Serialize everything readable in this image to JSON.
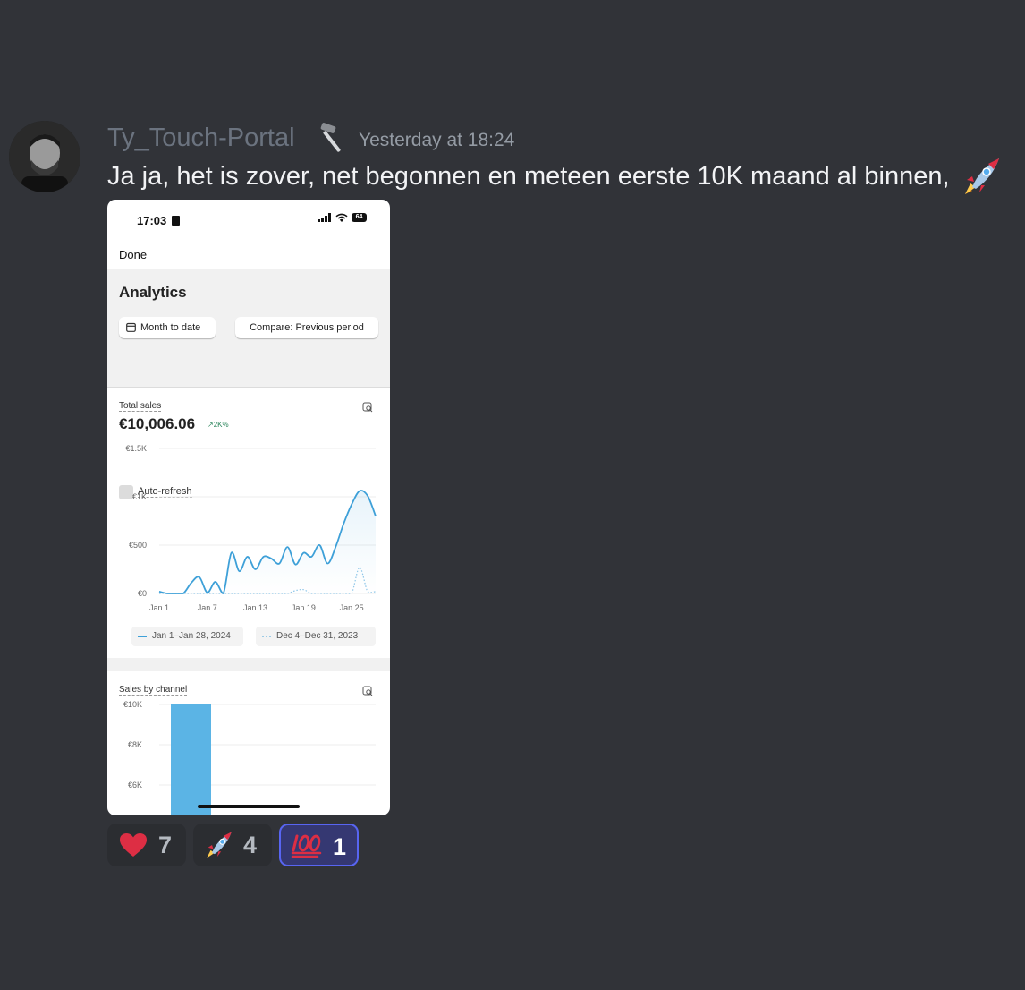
{
  "message": {
    "username": "Ty_Touch-Portal",
    "username_icon": "hammer-icon",
    "timestamp": "Yesterday at 18:24",
    "text": "Ja ja, het is zover, net begonnen en meteen eerste 10K maand al binnen,",
    "trailing_emoji": "rocket-emoji",
    "colors": {
      "background": "#313338",
      "username": "#6b737f",
      "text": "#f2f3f5",
      "timestamp": "#949ba4"
    }
  },
  "attachment": {
    "status_bar": {
      "time": "17:03",
      "battery": "64"
    },
    "done_label": "Done",
    "title": "Analytics",
    "date_filter": "Month to date",
    "compare_filter": "Compare: Previous period",
    "auto_refresh_label": "Auto-refresh",
    "auto_refresh_checked": false,
    "total_sales": {
      "label": "Total sales",
      "value": "€10,006.06",
      "delta": "2K%",
      "delta_direction": "up"
    },
    "sales_by_channel_label": "Sales by channel",
    "accent_color": "#3ea0d8"
  },
  "chart_data": [
    {
      "type": "line",
      "title": "Total sales",
      "x_ticks": [
        "Jan 1",
        "Jan 7",
        "Jan 13",
        "Jan 19",
        "Jan 25"
      ],
      "y_ticks": [
        "€0",
        "€500",
        "€1K",
        "€1.5K"
      ],
      "ylim": [
        0,
        1500
      ],
      "grid": true,
      "legend_position": "bottom",
      "series": [
        {
          "name": "Jan 1–Jan 28, 2024",
          "style": "solid",
          "x": [
            1,
            2,
            3,
            4,
            5,
            6,
            7,
            8,
            9,
            10,
            11,
            12,
            13,
            14,
            15,
            16,
            17,
            18,
            19,
            20,
            21,
            22,
            23,
            24,
            25,
            26,
            27,
            28
          ],
          "values": [
            20,
            0,
            0,
            0,
            110,
            170,
            10,
            120,
            0,
            420,
            230,
            380,
            250,
            380,
            360,
            310,
            480,
            300,
            420,
            380,
            500,
            310,
            480,
            720,
            920,
            1060,
            1010,
            800
          ]
        },
        {
          "name": "Dec 4–Dec 31, 2023",
          "style": "dotted",
          "x": [
            1,
            2,
            3,
            4,
            5,
            6,
            7,
            8,
            9,
            10,
            11,
            12,
            13,
            14,
            15,
            16,
            17,
            18,
            19,
            20,
            21,
            22,
            23,
            24,
            25,
            26,
            27,
            28
          ],
          "values": [
            0,
            0,
            0,
            0,
            0,
            0,
            0,
            0,
            0,
            0,
            0,
            0,
            0,
            0,
            0,
            0,
            0,
            30,
            40,
            0,
            0,
            0,
            0,
            0,
            0,
            270,
            20,
            20
          ]
        }
      ]
    },
    {
      "type": "bar",
      "title": "Sales by channel",
      "y_ticks": [
        "€6K",
        "€8K",
        "€10K"
      ],
      "categories": [
        ""
      ],
      "values": [
        10006.06
      ],
      "color": "#5bb4e5"
    }
  ],
  "reactions": [
    {
      "emoji": "red-heart-emoji",
      "count": "7",
      "active": false
    },
    {
      "emoji": "rocket-emoji",
      "count": "4",
      "active": false
    },
    {
      "emoji": "hundred-points-emoji",
      "count": "1",
      "active": true
    }
  ]
}
